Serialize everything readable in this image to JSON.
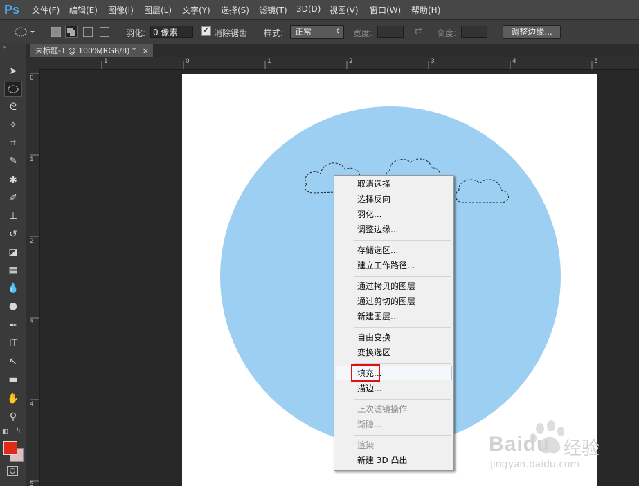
{
  "app": {
    "logo": "Ps"
  },
  "menu": [
    "文件(F)",
    "编辑(E)",
    "图像(I)",
    "图层(L)",
    "文字(Y)",
    "选择(S)",
    "滤镜(T)",
    "3D(D)",
    "视图(V)",
    "窗口(W)",
    "帮助(H)"
  ],
  "options": {
    "feather_label": "羽化:",
    "feather_value": "0 像素",
    "antialias_label": "消除锯齿",
    "style_label": "样式:",
    "style_value": "正常",
    "width_label": "宽度:",
    "height_label": "高度:",
    "refine_button": "调整边缘..."
  },
  "document": {
    "tab_title": "未标题-1 @ 100%(RGB/8) *",
    "close": "×"
  },
  "ruler": {
    "h_labels": [
      "1",
      "0",
      "1",
      "2",
      "3",
      "4",
      "5"
    ],
    "v_labels": [
      "0",
      "1",
      "2",
      "3",
      "4",
      "5"
    ]
  },
  "context_menu": {
    "items": [
      "取消选择",
      "选择反向",
      "羽化...",
      "调整边缘...",
      "存储选区...",
      "建立工作路径...",
      "通过拷贝的图层",
      "通过剪切的图层",
      "新建图层...",
      "自由变换",
      "变换选区",
      "填充...",
      "描边...",
      "上次滤镜操作",
      "渐隐...",
      "渲染",
      "新建 3D 凸出"
    ],
    "highlighted": "填充..."
  },
  "colors": {
    "circle": "#9dcff3",
    "foreground": "#e02a1a",
    "background": "#ddbfbf",
    "highlight_box": "#e01010"
  },
  "watermark": {
    "brand": "Baidu",
    "brand_cn": "经验",
    "url": "jingyan.baidu.com"
  }
}
